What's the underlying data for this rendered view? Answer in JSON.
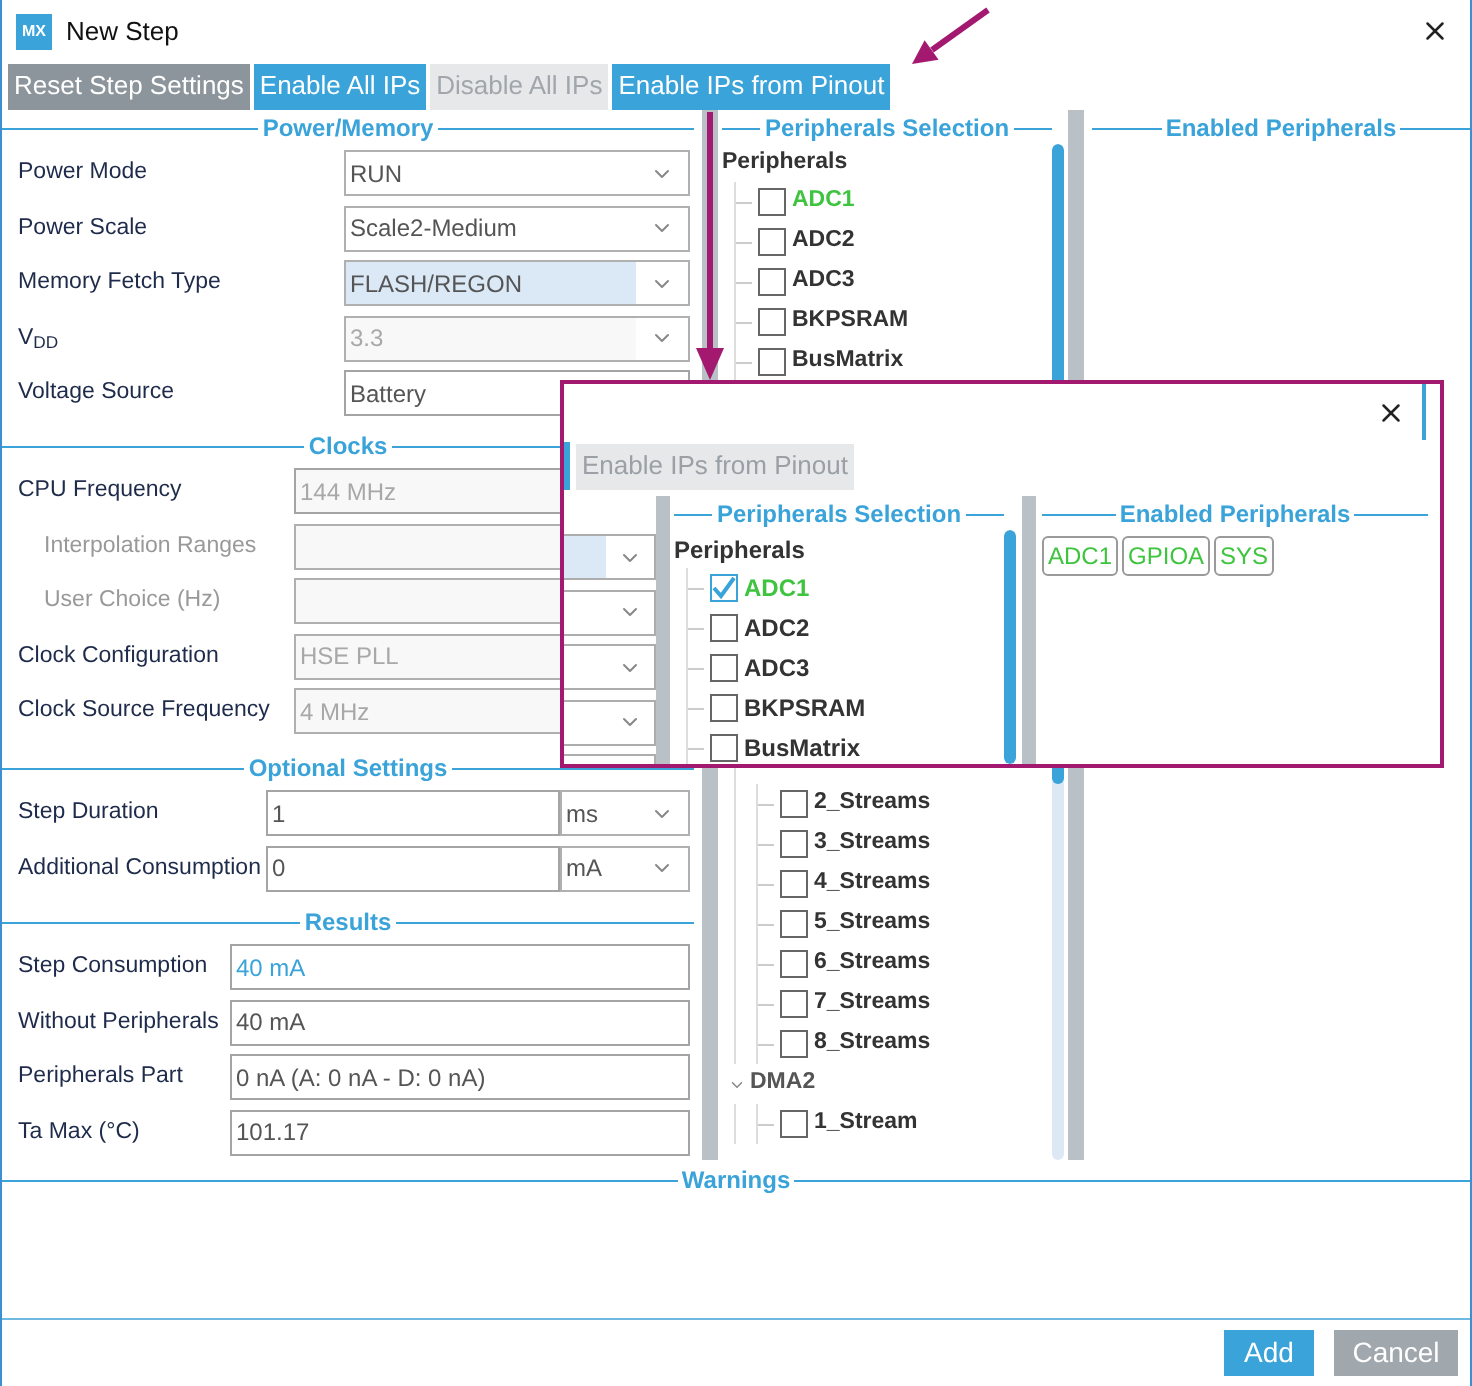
{
  "window": {
    "title": "New Step",
    "logo": "MX"
  },
  "toolbar": [
    {
      "label": "Reset Step Settings",
      "kind": "neutral",
      "disabled": false
    },
    {
      "label": "Enable All IPs",
      "kind": "primary",
      "disabled": false
    },
    {
      "label": "Disable All IPs",
      "kind": "primary",
      "disabled": true
    },
    {
      "label": "Enable IPs from Pinout",
      "kind": "primary",
      "disabled": false
    }
  ],
  "sections": [
    {
      "title": "Power/Memory",
      "rows": [
        {
          "label": "Power Mode",
          "value": "RUN",
          "kind": "select",
          "disabled": false,
          "focused": false
        },
        {
          "label": "Power Scale",
          "value": "Scale2-Medium",
          "kind": "select",
          "disabled": false,
          "focused": false
        },
        {
          "label": "Memory Fetch Type",
          "value": "FLASH/REGON",
          "kind": "select",
          "disabled": false,
          "focused": true
        },
        {
          "label": "V$_{DD}$",
          "value": "3.3",
          "kind": "select",
          "disabled": true,
          "focused": false
        },
        {
          "label": "Voltage Source",
          "value": "Battery",
          "kind": "text",
          "disabled": false,
          "focused": false
        }
      ]
    },
    {
      "title": "Clocks",
      "rows": [
        {
          "label": "CPU Frequency",
          "value": "144 MHz",
          "kind": "text",
          "disabled": true,
          "children": [
            {
              "label": "Interpolation Ranges",
              "kind": "select",
              "disabled": true
            },
            {
              "label": "User Choice (Hz)",
              "kind": "select",
              "disabled": true
            }
          ]
        },
        {
          "label": "Clock Configuration",
          "value": "HSE PLL",
          "kind": "select",
          "disabled": true
        },
        {
          "label": "Clock Source Frequency",
          "value": "4 MHz",
          "kind": "select",
          "disabled": true
        }
      ]
    },
    {
      "title": "Optional Settings",
      "rows": [
        {
          "label": "Step Duration",
          "value": "1",
          "kind": "text",
          "disabled": false,
          "unit": {
            "value": "ms",
            "kind": "select"
          }
        },
        {
          "label": "Additional Consumption",
          "value": "0",
          "kind": "text",
          "disabled": false,
          "unit": {
            "value": "mA",
            "kind": "select"
          }
        }
      ]
    },
    {
      "title": "Results",
      "rows": [
        {
          "label": "Step Consumption",
          "value": "40 mA",
          "kind": "text",
          "disabled": false,
          "accent": true
        },
        {
          "label": "Without Peripherals",
          "value": "40 mA",
          "kind": "text",
          "disabled": false,
          "accent": false
        },
        {
          "label": "Peripherals Part",
          "value": "0 nA  (A: 0 nA - D: 0 nA)",
          "kind": "text",
          "disabled": false,
          "accent": false
        },
        {
          "label": "Ta Max (°C)",
          "value": "101.17",
          "kind": "text",
          "disabled": false,
          "accent": false
        }
      ]
    }
  ],
  "peripherals": {
    "title": "Peripherals Selection",
    "root": "Peripherals",
    "items": [
      {
        "label": "ADC1",
        "checked": false,
        "enabled": true
      },
      {
        "label": "ADC2",
        "checked": false,
        "enabled": false
      },
      {
        "label": "ADC3",
        "checked": false,
        "enabled": false
      },
      {
        "label": "BKPSRAM",
        "checked": false,
        "enabled": false
      },
      {
        "label": "BusMatrix",
        "checked": false,
        "enabled": false
      }
    ],
    "lower_items": [
      {
        "children": [
          {
            "label": "2_Streams",
            "checked": false,
            "enabled": false
          },
          {
            "label": "3_Streams",
            "checked": false,
            "enabled": false
          },
          {
            "label": "4_Streams",
            "checked": false,
            "enabled": false
          },
          {
            "label": "5_Streams",
            "checked": false,
            "enabled": false
          },
          {
            "label": "6_Streams",
            "checked": false,
            "enabled": false
          },
          {
            "label": "7_Streams",
            "checked": false,
            "enabled": false
          },
          {
            "label": "8_Streams",
            "checked": false,
            "enabled": false
          }
        ]
      },
      {
        "label": "DMA2",
        "expanded": true,
        "children": [
          {
            "label": "1_Stream",
            "checked": false,
            "enabled": false
          }
        ]
      }
    ]
  },
  "enabled_peripherals": {
    "title": "Enabled Peripherals"
  },
  "warnings": {
    "title": "Warnings"
  },
  "buttons": [
    {
      "label": "Add",
      "kind": "primary"
    },
    {
      "label": "Cancel",
      "kind": "neutral"
    }
  ],
  "inset": {
    "button": {
      "label": "Enable IPs from Pinout",
      "disabled": true
    },
    "peripherals": {
      "title": "Peripherals Selection",
      "root": "Peripherals",
      "items": [
        {
          "label": "ADC1",
          "checked": true,
          "enabled": true
        },
        {
          "label": "ADC2",
          "checked": false,
          "enabled": false
        },
        {
          "label": "ADC3",
          "checked": false,
          "enabled": false
        },
        {
          "label": "BKPSRAM",
          "checked": false,
          "enabled": false
        },
        {
          "label": "BusMatrix",
          "checked": false,
          "enabled": false
        }
      ]
    },
    "enabled_peripherals": {
      "title": "Enabled Peripherals",
      "chips": [
        "ADC1",
        "GPIOA",
        "SYS"
      ]
    }
  }
}
